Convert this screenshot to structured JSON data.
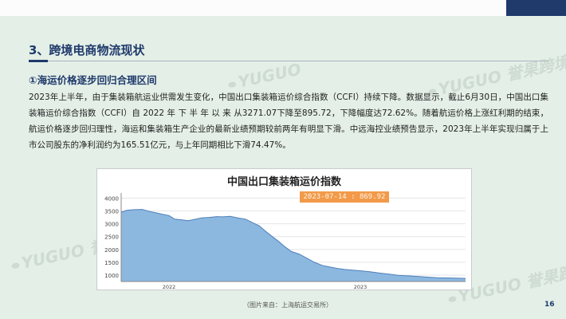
{
  "section": {
    "title": "3、跨境电商物流现状"
  },
  "subsection": {
    "title": "①海运价格逐步回归合理区间"
  },
  "body": {
    "paragraph": "2023年上半年，由于集装箱航运业供需发生变化，中国出口集装箱运价综合指数（CCFI）持续下降。数据显示，截止6月30日，中国出口集装箱运价综合指数（CCFI）自 2022 年 下 半 年 以 来 从3271.07下降至895.72，下降幅度达72.62%。随着航运价格上涨红利期的结束，航运价格逐步回归理性，海运和集装箱生产企业的最新业绩预期较前两年有明显下滑。中远海控业绩预告显示，2023年上半年实现归属于上市公司股东的净利润约为165.51亿元，与上年同期相比下滑74.47%。"
  },
  "watermark": {
    "text": "YUGUO",
    "text_cn": "誉果跨境",
    "color": "#b4c3b9"
  },
  "chart_data": {
    "type": "area",
    "title": "中国出口集装箱运价指数",
    "tooltip": "2023-07-14 : 869.92",
    "y_ticks": [
      "4000",
      "3500",
      "3000",
      "2500",
      "2000",
      "1500",
      "1000"
    ],
    "x_ticks": [
      "2022",
      "2023"
    ],
    "ylim": [
      750,
      4200
    ],
    "xlim": [
      2021.75,
      2023.55
    ],
    "fill_color": "#8cb8e0",
    "line_color": "#4d7fb8",
    "series": [
      {
        "x": [
          2021.75,
          2021.78,
          2021.82,
          2021.86,
          2021.9,
          2021.93,
          2021.96,
          2022.0,
          2022.03,
          2022.07,
          2022.1,
          2022.14,
          2022.17,
          2022.21,
          2022.25,
          2022.28,
          2022.32,
          2022.36,
          2022.4,
          2022.43,
          2022.47,
          2022.5,
          2022.53,
          2022.57,
          2022.61,
          2022.64,
          2022.68,
          2022.72,
          2022.76,
          2022.8,
          2022.84,
          2022.88,
          2022.92,
          2022.96,
          2023.0,
          2023.05,
          2023.1,
          2023.15,
          2023.2,
          2023.25,
          2023.3,
          2023.35,
          2023.4,
          2023.45,
          2023.5,
          2023.55
        ],
        "y": [
          3450,
          3530,
          3550,
          3560,
          3480,
          3430,
          3380,
          3320,
          3180,
          3150,
          3120,
          3180,
          3230,
          3250,
          3280,
          3270,
          3290,
          3230,
          3180,
          3070,
          2930,
          2740,
          2560,
          2330,
          2080,
          1920,
          1820,
          1660,
          1500,
          1380,
          1320,
          1260,
          1220,
          1190,
          1170,
          1130,
          1080,
          1040,
          990,
          970,
          950,
          920,
          900,
          890,
          880,
          870
        ]
      }
    ]
  },
  "footer": {
    "source": "（图片来自：上海航运交易所）",
    "page_number": "16"
  }
}
